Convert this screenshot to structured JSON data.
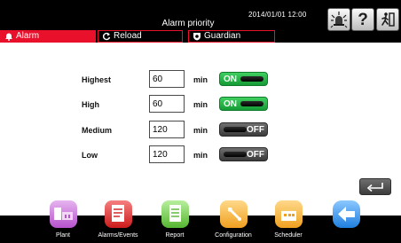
{
  "header": {
    "title": "Alarm priority",
    "datetime": "2014/01/01  12:00",
    "buttons": {
      "alarm_light_icon": "alarm-light-icon",
      "help_label": "?",
      "logout_icon": "logout-icon"
    }
  },
  "tabs": [
    {
      "label": "Alarm",
      "icon": "bell-icon",
      "active": true
    },
    {
      "label": "Reload",
      "icon": "reload-icon",
      "active": false
    },
    {
      "label": "Guardian",
      "icon": "shield-icon",
      "active": false
    }
  ],
  "priorities": [
    {
      "label": "Highest",
      "value": "60",
      "unit": "min",
      "toggle": "ON"
    },
    {
      "label": "High",
      "value": "60",
      "unit": "min",
      "toggle": "ON"
    },
    {
      "label": "Medium",
      "value": "120",
      "unit": "min",
      "toggle": "OFF"
    },
    {
      "label": "Low",
      "value": "120",
      "unit": "min",
      "toggle": "OFF"
    }
  ],
  "nav": [
    {
      "label": "Plant",
      "icon": "plant-icon"
    },
    {
      "label": "Alarms/Events",
      "icon": "alarms-events-icon"
    },
    {
      "label": "Report",
      "icon": "report-icon"
    },
    {
      "label": "Configuration",
      "icon": "configuration-icon"
    },
    {
      "label": "Scheduler",
      "icon": "scheduler-icon"
    },
    {
      "label": "",
      "icon": "back-arrow-icon"
    }
  ],
  "colors": {
    "accent_red": "#e8102a",
    "toggle_on": "#1fb141",
    "toggle_off": "#4a4a4a"
  }
}
